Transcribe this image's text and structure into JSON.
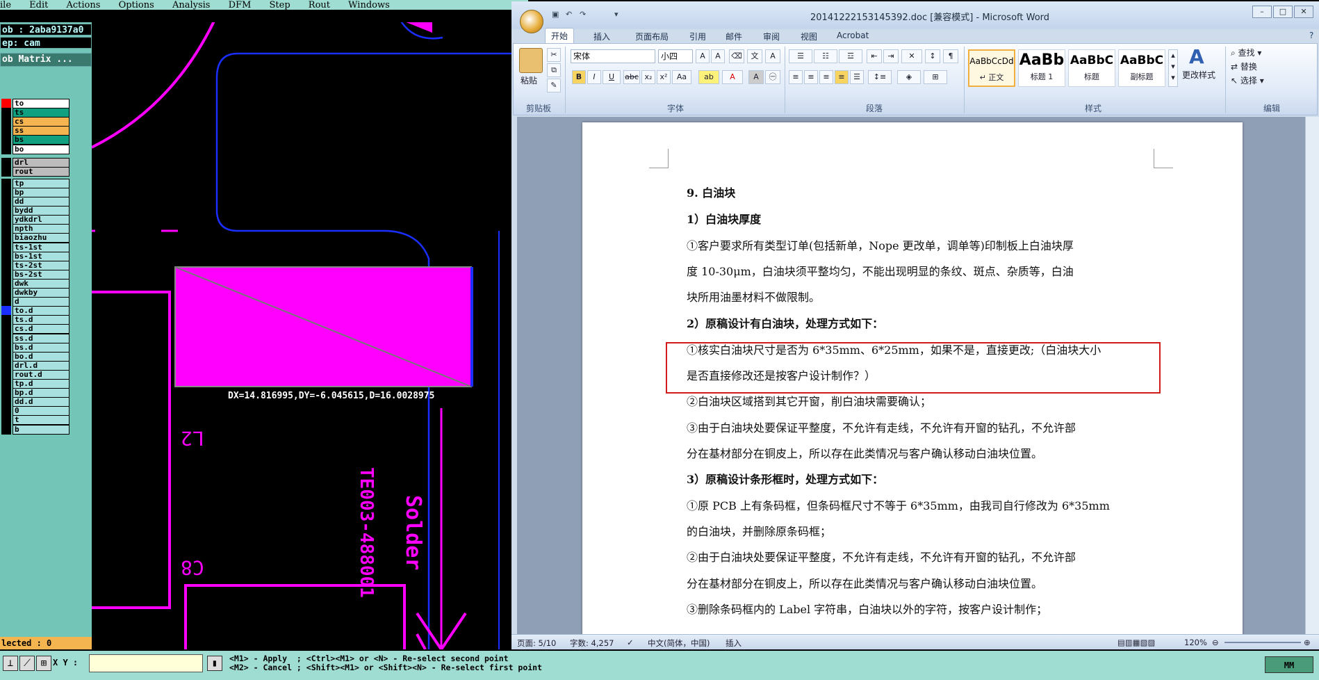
{
  "cam": {
    "menu": [
      "ile",
      "Edit",
      "Actions",
      "Options",
      "Analysis",
      "DFM",
      "Step",
      "Rout",
      "Windows"
    ],
    "job_label": "ob : 2aba9137a0",
    "step_label": "ep: cam",
    "matrix_button": "ob Matrix ...",
    "layers": [
      {
        "name": "to",
        "color": "white",
        "swatch": "#ff0000"
      },
      {
        "name": "ts",
        "color": "green"
      },
      {
        "name": "cs",
        "color": "orange"
      },
      {
        "name": "ss",
        "color": "orange"
      },
      {
        "name": "bs",
        "color": "green"
      },
      {
        "name": "bo",
        "color": "white"
      },
      {
        "name": "drl",
        "color": "gray"
      },
      {
        "name": "rout",
        "color": "gray"
      },
      {
        "name": "tp"
      },
      {
        "name": "bp"
      },
      {
        "name": "dd"
      },
      {
        "name": "bydd"
      },
      {
        "name": "ydkdrl"
      },
      {
        "name": "npth"
      },
      {
        "name": "biaozhu"
      },
      {
        "name": "ts-1st"
      },
      {
        "name": "bs-1st"
      },
      {
        "name": "ts-2st"
      },
      {
        "name": "bs-2st"
      },
      {
        "name": "dwk"
      },
      {
        "name": "dwkby"
      },
      {
        "name": "d"
      },
      {
        "name": "to.d",
        "swatch": "#1a2fff"
      },
      {
        "name": "ts.d"
      },
      {
        "name": "cs.d"
      },
      {
        "name": "ss.d"
      },
      {
        "name": "bs.d"
      },
      {
        "name": "bo.d"
      },
      {
        "name": "drl.d"
      },
      {
        "name": "rout.d"
      },
      {
        "name": "tp.d"
      },
      {
        "name": "bp.d"
      },
      {
        "name": "dd.d"
      },
      {
        "name": "0"
      },
      {
        "name": "t"
      },
      {
        "name": "b"
      }
    ],
    "selected_label": "lected : 0",
    "measure_text": "DX=14.816995,DY=-6.045615,D=16.0028975",
    "silk_texts": [
      "L2",
      "C8",
      "TE003-488001",
      "Solder"
    ],
    "xy_label": "X Y :",
    "hint_line1": "<M1> - Apply  ; <Ctrl><M1> or <N> - Re-select second point",
    "hint_line2": "<M2> - Cancel ; <Shift><M1> or <Shift><N> - Re-select first point",
    "units": "MM"
  },
  "word": {
    "title": "20141222153145392.doc [兼容模式] - Microsoft Word",
    "tabs": [
      "开始",
      "插入",
      "页面布局",
      "引用",
      "邮件",
      "审阅",
      "视图",
      "Acrobat"
    ],
    "font_name": "宋体",
    "font_size": "小四",
    "paste_label": "粘贴",
    "groups": [
      "剪贴板",
      "字体",
      "段落",
      "样式",
      "编辑"
    ],
    "styles": [
      {
        "sample": "AaBbCcDd",
        "name": "↵ 正文"
      },
      {
        "sample": "AaBb",
        "name": "标题 1"
      },
      {
        "sample": "AaBbC",
        "name": "标题"
      },
      {
        "sample": "AaBbC",
        "name": "副标题"
      }
    ],
    "change_styles": "更改样式",
    "edit_items": [
      "查找 ▾",
      "替换",
      "选择 ▾"
    ],
    "doc_lines": [
      "9. 白油块",
      "1）白油块厚度",
      "①客户要求所有类型订单(包括新单，Nope 更改单，调单等)印制板上白油块厚",
      "度 10-30μm，白油块须平整均匀，不能出现明显的条纹、斑点、杂质等，白油",
      "块所用油墨材料不做限制。",
      "2）原稿设计有白油块，处理方式如下：",
      "①核实白油块尺寸是否为 6*35mm、6*25mm，如果不是，直接更改;（白油块大小",
      "是否直接修改还是按客户设计制作？）",
      "②白油块区域搭到其它开窗，削白油块需要确认；",
      "③由于白油块处要保证平整度，不允许有走线，不允许有开窗的钻孔，不允许部",
      "分在基材部分在铜皮上，所以存在此类情况与客户确认移动白油块位置。",
      "3）原稿设计条形框时，处理方式如下：",
      "①原 PCB 上有条码框，但条码框尺寸不等于 6*35mm，由我司自行修改为 6*35mm",
      "的白油块，并删除原条码框；",
      "②由于白油块处要保证平整度，不允许有走线，不允许有开窗的钻孔，不允许部",
      "分在基材部分在铜皮上，所以存在此类情况与客户确认移动白油块位置。",
      "③删除条码框内的 Label 字符串，白油块以外的字符，按客户设计制作；"
    ],
    "status": {
      "page": "页面: 5/10",
      "words": "字数: 4,257",
      "language": "中文(简体，中国)",
      "mode": "插入",
      "zoom": "120%"
    }
  }
}
